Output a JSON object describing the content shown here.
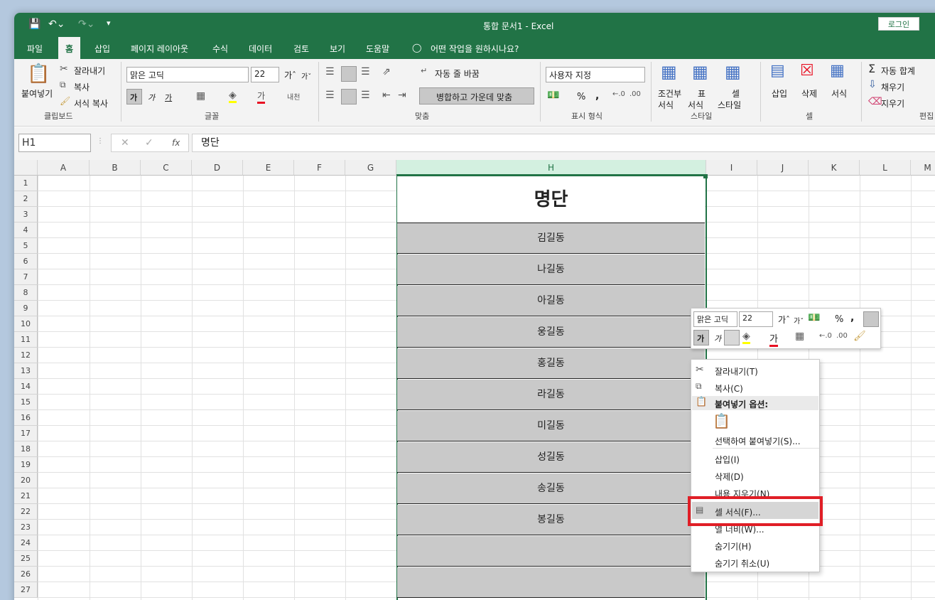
{
  "title_bar": {
    "title": "통합 문서1 - Excel",
    "login_label": "로그인"
  },
  "tabs": [
    "파일",
    "홈",
    "삽입",
    "페이지 레이아웃",
    "수식",
    "데이터",
    "검토",
    "보기",
    "도움말"
  ],
  "tell_me": "어떤 작업을 원하시나요?",
  "ribbon": {
    "clipboard": {
      "paste": "붙여넣기",
      "cut": "잘라내기",
      "copy": "복사",
      "format_painter": "서식 복사",
      "group": "클립보드"
    },
    "font": {
      "name": "맑은 고딕",
      "size": "22",
      "bold": "가",
      "italic": "가",
      "underline": "가",
      "group": "글꼴"
    },
    "alignment": {
      "wrap": "자동 줄 바꿈",
      "merge": "병합하고 가운데 맞춤",
      "group": "맞춤"
    },
    "number": {
      "format": "사용자 지정",
      "percent": "%",
      "comma": ",",
      "group": "표시 형식"
    },
    "styles": {
      "conditional_top": "조건부",
      "conditional_bottom": "서식",
      "table_top": "표",
      "table_bottom": "서식",
      "cell_top": "셀",
      "cell_bottom": "스타일",
      "group": "스타일"
    },
    "cells": {
      "insert": "삽입",
      "delete": "삭제",
      "format": "서식",
      "group": "셀"
    },
    "editing": {
      "autosum": "자동 합계",
      "fill": "채우기",
      "clear": "지우기",
      "group": "편집"
    }
  },
  "formula_bar": {
    "name_box": "H1",
    "fx": "fx",
    "content": "명단"
  },
  "columns": [
    "A",
    "B",
    "C",
    "D",
    "E",
    "F",
    "G",
    "H",
    "I",
    "J",
    "K",
    "L",
    "M"
  ],
  "rows": [
    "1",
    "2",
    "3",
    "4",
    "5",
    "6",
    "7",
    "8",
    "9",
    "10",
    "11",
    "12",
    "13",
    "14",
    "15",
    "16",
    "17",
    "18",
    "19",
    "20",
    "21",
    "22",
    "23",
    "24",
    "25",
    "26",
    "27"
  ],
  "sheet": {
    "header": "명단",
    "names": [
      "김길동",
      "나길동",
      "아길동",
      "웅길동",
      "홍길동",
      "라길동",
      "미길동",
      "성길동",
      "송길동",
      "봉길동",
      "",
      ""
    ]
  },
  "mini_toolbar": {
    "font": "맑은 고딕",
    "size": "22",
    "percent": "%",
    "comma": ",",
    "bold": "가",
    "italic": "가",
    "font_color": "가"
  },
  "context_menu": {
    "cut": "잘라내기(T)",
    "copy": "복사(C)",
    "paste_options": "붙여넣기 옵션:",
    "paste_special": "선택하여 붙여넣기(S)...",
    "insert": "삽입(I)",
    "delete": "삭제(D)",
    "clear": "내용 지우기(N)",
    "format_cells": "셀 서식(F)...",
    "row_height": "열 너비(W)...",
    "hide": "숨기기(H)",
    "unhide": "숨기기 취소(U)"
  },
  "colors": {
    "accent": "#217346",
    "highlight_box": "#e01e26",
    "selected_cell_fill": "#c9c9c9"
  }
}
